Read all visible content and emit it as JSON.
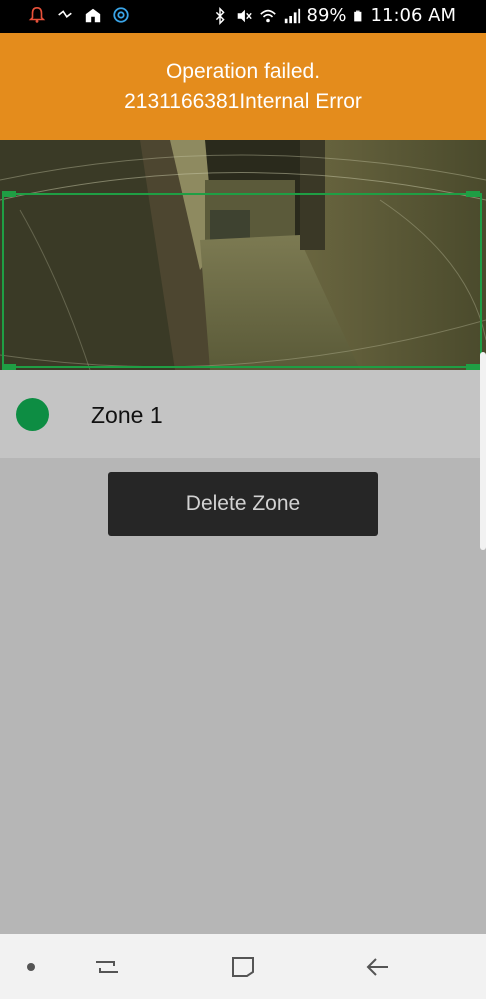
{
  "status_bar": {
    "battery": "89%",
    "time": "11:06 AM",
    "left_icons": [
      "bell-icon",
      "ifttt-icon",
      "home-icon",
      "sync-icon"
    ],
    "right_icons": [
      "bluetooth-icon",
      "mute-icon",
      "wifi-icon",
      "signal-icon",
      "battery-icon"
    ]
  },
  "error": {
    "title": "Operation failed.",
    "message": "2131166381Internal Error"
  },
  "zone": {
    "name": "Zone 1",
    "color": "#0d8d43"
  },
  "actions": {
    "delete_label": "Delete Zone"
  },
  "nav": {
    "items": [
      "dot-icon",
      "recents-icon",
      "home-icon",
      "back-icon"
    ]
  },
  "colors": {
    "banner": "#e48c1c",
    "zone_outline": "#1f9e44",
    "background": "#b6b6b6"
  }
}
